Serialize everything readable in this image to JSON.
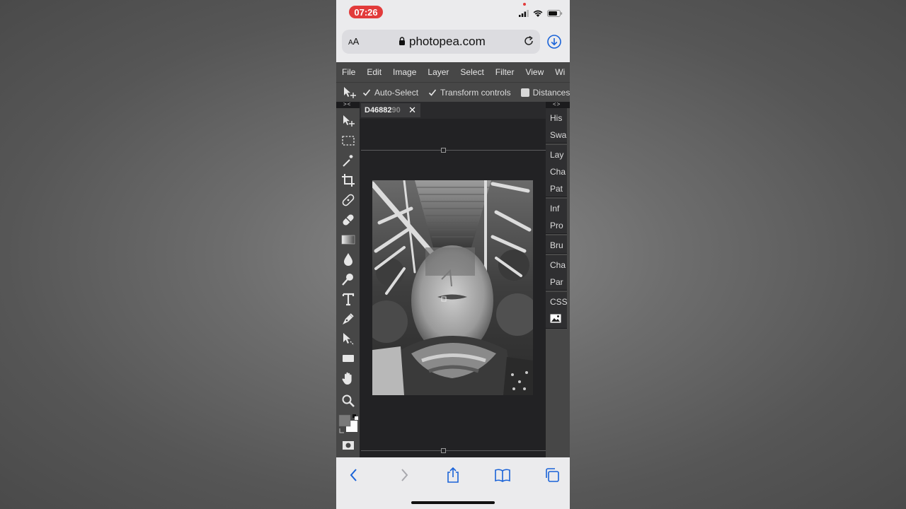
{
  "status_bar": {
    "time": "07:26"
  },
  "browser": {
    "text_size_label": "AA",
    "url": "photopea.com"
  },
  "menu": {
    "items": [
      "File",
      "Edit",
      "Image",
      "Layer",
      "Select",
      "Filter",
      "View",
      "Wi"
    ]
  },
  "options_bar": {
    "auto_select": {
      "label": "Auto-Select",
      "checked": true
    },
    "transform_controls": {
      "label": "Transform controls",
      "checked": true
    },
    "distances": {
      "label": "Distances",
      "checked": false
    }
  },
  "collapse_markers": {
    "left": "><",
    "right": "<>"
  },
  "document": {
    "tab_name": "D4688290",
    "tab_name_visible": "D46882",
    "tab_name_faded": "90",
    "close_glyph": "✕"
  },
  "tools": [
    "move-tool",
    "rectangular-marquee-tool",
    "magic-wand-tool",
    "crop-tool",
    "healing-brush-tool",
    "eraser-tool",
    "gradient-tool",
    "blur-tool",
    "dodge-tool",
    "type-tool",
    "pen-tool",
    "path-select-tool",
    "rectangle-tool",
    "hand-tool",
    "zoom-tool"
  ],
  "right_panel": {
    "groups": [
      [
        "His",
        "Swa"
      ],
      [
        "Lay",
        "Cha",
        "Pat"
      ],
      [
        "Inf",
        "Pro"
      ],
      [
        "Bru"
      ],
      [
        "Cha",
        "Par"
      ],
      [
        "CSS"
      ]
    ]
  },
  "colors": {
    "time_pill": "#e23b3b",
    "ui_panel": "#474747",
    "canvas_bg": "#222224",
    "safari_blue": "#1a63d8"
  }
}
